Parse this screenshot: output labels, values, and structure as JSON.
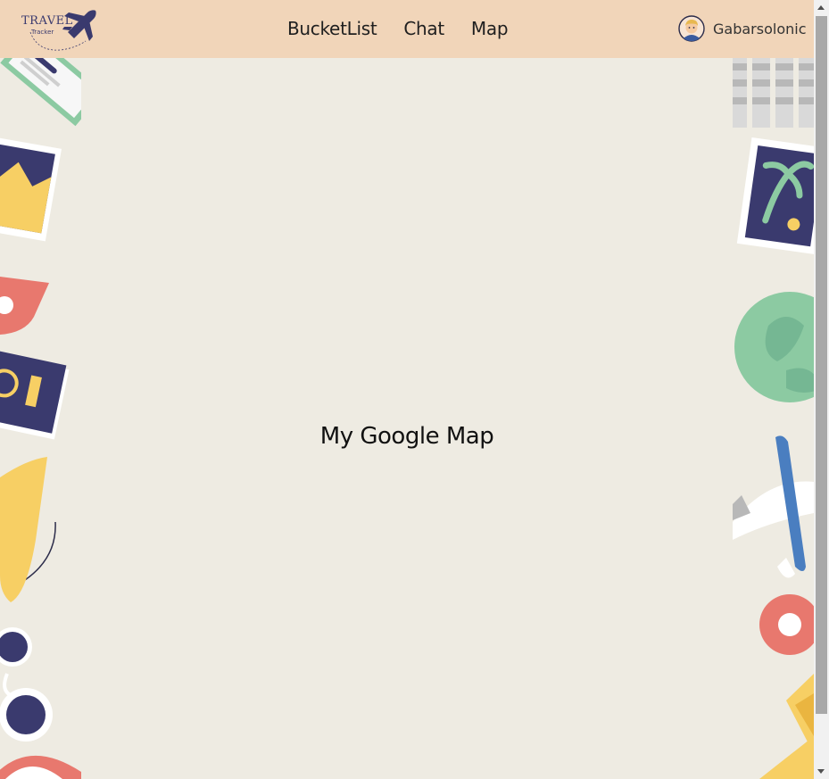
{
  "brand": {
    "title": "TRAVEL",
    "subtitle": "Tracker"
  },
  "nav": {
    "links": [
      {
        "label": "BucketList"
      },
      {
        "label": "Chat"
      },
      {
        "label": "Map"
      }
    ]
  },
  "user": {
    "name": "Gabarsolonic"
  },
  "main": {
    "title": "My Google Map"
  },
  "colors": {
    "navbar": "#f1d5b9",
    "background": "#eeebe2",
    "navy": "#3a3a6e",
    "green": "#8ccaa2",
    "yellow": "#f7cf64",
    "coral": "#e8786e"
  }
}
